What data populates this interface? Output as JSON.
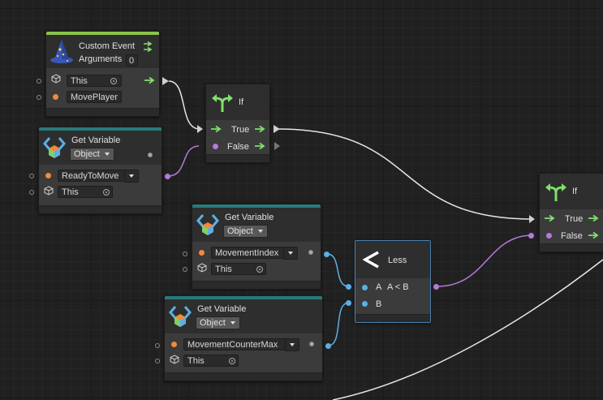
{
  "custom_event": {
    "title": "Custom Event",
    "arguments_label": "Arguments",
    "arguments_value": "0",
    "target_value": "This",
    "name_value": "MovePlayer"
  },
  "if_1": {
    "title": "If",
    "true_label": "True",
    "false_label": "False"
  },
  "if_2": {
    "title": "If",
    "true_label": "True",
    "false_label": "False"
  },
  "get_var_1": {
    "title": "Get Variable",
    "kind": "Object",
    "name_value": "ReadyToMove",
    "target_value": "This"
  },
  "get_var_2": {
    "title": "Get Variable",
    "kind": "Object",
    "name_value": "MovementIndex",
    "target_value": "This"
  },
  "get_var_3": {
    "title": "Get Variable",
    "kind": "Object",
    "name_value": "MovementCounterMax",
    "target_value": "This"
  },
  "less": {
    "title": "Less",
    "a_label": "A",
    "result_label": "A < B",
    "b_label": "B"
  },
  "colors": {
    "background": "#202020",
    "event_accent": "#8bc34a",
    "variable_accent": "#2a7a7a",
    "control_arrow": "#7fe06a",
    "string_port": "#f08a3c",
    "number_port": "#5ab0e6",
    "bool_port": "#b47bd8"
  }
}
